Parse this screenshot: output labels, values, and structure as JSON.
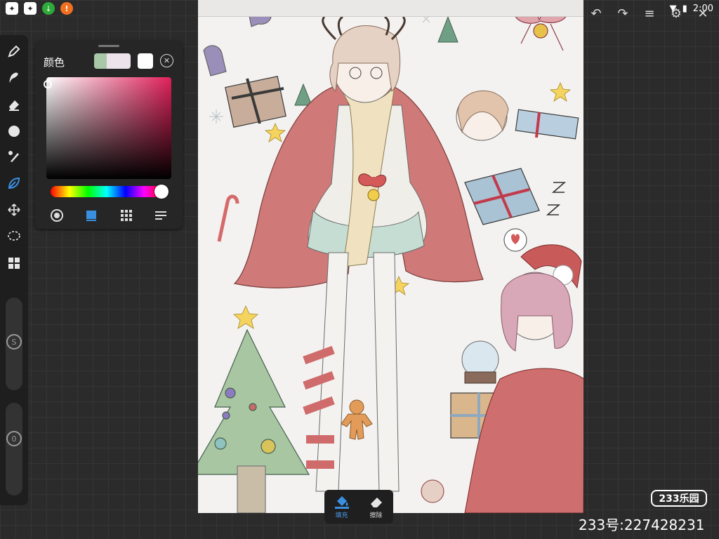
{
  "status_bar": {
    "time": "2:00",
    "left_icons": [
      "paw-app-icon",
      "paw-app-icon",
      "download-icon",
      "warning-icon"
    ],
    "right_icons": [
      "wifi-icon",
      "battery-icon"
    ]
  },
  "top_actions": {
    "icons": [
      "undo-icon",
      "redo-icon",
      "layers-icon",
      "settings-icon",
      "close-icon"
    ]
  },
  "toolbar": {
    "tools": [
      {
        "name": "pen-tool",
        "icon": "pen-icon"
      },
      {
        "name": "smudge-tool",
        "icon": "smudge-icon"
      },
      {
        "name": "eraser-tool",
        "icon": "eraser-icon"
      },
      {
        "name": "color-tool",
        "icon": "circle-icon"
      },
      {
        "name": "brush-tool",
        "icon": "brush-icon"
      },
      {
        "name": "fill-tool",
        "icon": "leaf-icon",
        "active": true
      },
      {
        "name": "move-tool",
        "icon": "move-icon"
      },
      {
        "name": "lasso-tool",
        "icon": "lasso-icon"
      },
      {
        "name": "grid-tool",
        "icon": "grid-icon"
      }
    ],
    "size_label": "S",
    "opacity_label": "0"
  },
  "color_panel": {
    "title": "颜色",
    "primary_color": "#a8c8a8",
    "secondary_color": "#ece4ea",
    "current_color": "#ffffff",
    "hue_color": "#e0205a",
    "modes": [
      "disc-mode-icon",
      "classic-mode-icon",
      "palette-mode-icon",
      "value-mode-icon"
    ],
    "active_mode": 1
  },
  "fill_popup": {
    "fill_label": "填充",
    "erase_label": "擦除"
  },
  "watermark": {
    "logo_text": "233乐园",
    "id_text": "233号:227428231"
  }
}
